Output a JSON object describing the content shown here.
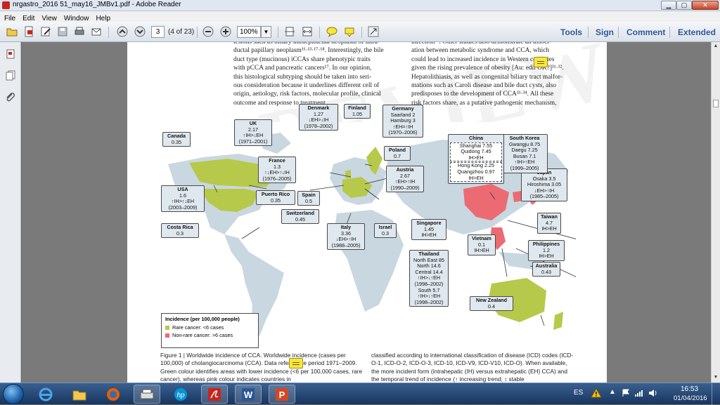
{
  "window": {
    "title": "nrgastro_2016 51_may16_JMBv1.pdf - Adobe Reader"
  },
  "menu": [
    "File",
    "Edit",
    "View",
    "Window",
    "Help"
  ],
  "toolbar": {
    "page_current": "3",
    "page_count": "(4 of 23)",
    "zoom": "100%"
  },
  "right_tabs": [
    "Tools",
    "Sign",
    "Comment",
    "Extended"
  ],
  "document": {
    "watermark": "nr REVIEWS",
    "col_left": [
      "lesions such as biliary intraepithelial neoplasm of intra-",
      "ductal papillary neoplasm¹¹·¹³·¹⁷·¹⁸. Interestingly, the bile",
      "duct type (mucinous) iCCAs share phenotypic traits",
      "with pCCA and pancreatic cancers¹⁷. In our opinion,",
      "this histological subtyping should be taken into seri-",
      "ous consideration because it underlines different cell of",
      "origin, aetiology, risk factors, molecular profile, clinical",
      "outcome and response to treatment."
    ],
    "col_right": [
      "infection²⁹. Other studies also demonstrate an associ-",
      "ation between metabolic syndrome and CCA, which",
      "could lead to increased incidence in Western countries",
      "given the rising prevalence of obesity [Au: edit OK?]³¹·³².",
      "Hepatolithiasis, as well as congenital biliary tract malfor-",
      "mations such as Caroli disease and bile duct cysts, also",
      "predisposes to the development of CCA³³·³⁴. All these",
      "risk factors share, as a putative pathogenic mechanism,"
    ],
    "map_labels": [
      {
        "name": "Canada",
        "data": "0.35"
      },
      {
        "name": "UK",
        "data": "2.17\n↑IH>↓EH\n(1971–2001)"
      },
      {
        "name": "Denmark",
        "data": "1.27\n↓EH>↓IH\n(1978–2002)"
      },
      {
        "name": "Finland",
        "data": "1.05"
      },
      {
        "name": "Germany",
        "data": "Saarland 2\nHamburg 3\n↑EH=↑IH\n(1970–2006)"
      },
      {
        "name": "Poland",
        "data": "0.7"
      },
      {
        "name": "France",
        "data": "1.3\n↑↓EH>↑↓IH\n(1976–2005)"
      },
      {
        "name": "Austria",
        "data": "2.67\n↑EH>↑IH\n(1990–2009)"
      },
      {
        "name": "USA",
        "data": "1.6\n↑IH>↑↓EH\n(2003–2009)"
      },
      {
        "name": "Puerto Rico",
        "data": "0.35"
      },
      {
        "name": "Spain",
        "data": "0.5"
      },
      {
        "name": "Switzerland",
        "data": "0.45"
      },
      {
        "name": "Costa Rica",
        "data": "0.3"
      },
      {
        "name": "Italy",
        "data": "3.36\n↓EH>↑IH\n(1988–2005)"
      },
      {
        "name": "Israel",
        "data": "0.3"
      },
      {
        "name": "Singapore",
        "data": "1.45\nIH>EH"
      },
      {
        "name": "Thailand",
        "data": "North East 85\nNorth 14.6\nCentral 14.4\n↑IH>↓↑EH\n(1998–2002)\nSouth 5.7\n↑IH>↓↑EH\n(1998–2002)"
      },
      {
        "name": "Vietnam",
        "data": "0.1\nIH>EH"
      },
      {
        "name": "New Zealand",
        "data": "0.4"
      },
      {
        "name": "Australia",
        "data": "0.43"
      },
      {
        "name": "Philippines",
        "data": "1.2\nIH>EH"
      },
      {
        "name": "Taiwan",
        "data": "4.7\nIH>EH"
      },
      {
        "name": "Japan",
        "data": "Osaka 3.5\nHiroshima 3.05\n↓EH>↑IH\n(1985–2005)"
      },
      {
        "name": "South Korea",
        "data": "Gwangju 8.75\nDaegu 7.25\nBusan 7.1\n↑IH>↑EH\n(1999–2005)"
      }
    ],
    "china": {
      "name": "China",
      "inner1": "Shanghai 7.55\nQuidong 7.45\nIH>EH",
      "inner2": "Hong Kong 2.25\nQuangzhou 0.97\nIH>EH"
    },
    "legend": {
      "title": "Incidence (per 100,000 people)",
      "rare": "Rare cancer: <6 cases",
      "nonrare": "Non-rare cancer: >6 cases",
      "rare_color": "#b7c94a",
      "nonrare_color": "#ec6b72"
    },
    "caption_left": "Figure 1 | Worldwide incidence of CCA. Worldwide incidence (cases per 100,000) of cholangiocarcinoma (CCA). Data refer to the period 1971–2009. Green colour identifies areas with lower incidence (<6 per 100,000 cases, rare cancer), whereas pink colour indicates countries in",
    "caption_right": "classified according to international classification of disease (ICD) codes (ICD-O-1, ICD-O-2, ICD-O-3, ICD-10, ICD-V9, ICD-V10, ICD-O). When available, the more incident form (intrahepatic (IH) versus extrahepatic (EH) CCA) and the temporal trend of incidence (↑ increasing trend; ↕ stable"
  },
  "taskbar": {
    "lang": "ES",
    "time": "16:53",
    "date": "01/04/2016"
  }
}
